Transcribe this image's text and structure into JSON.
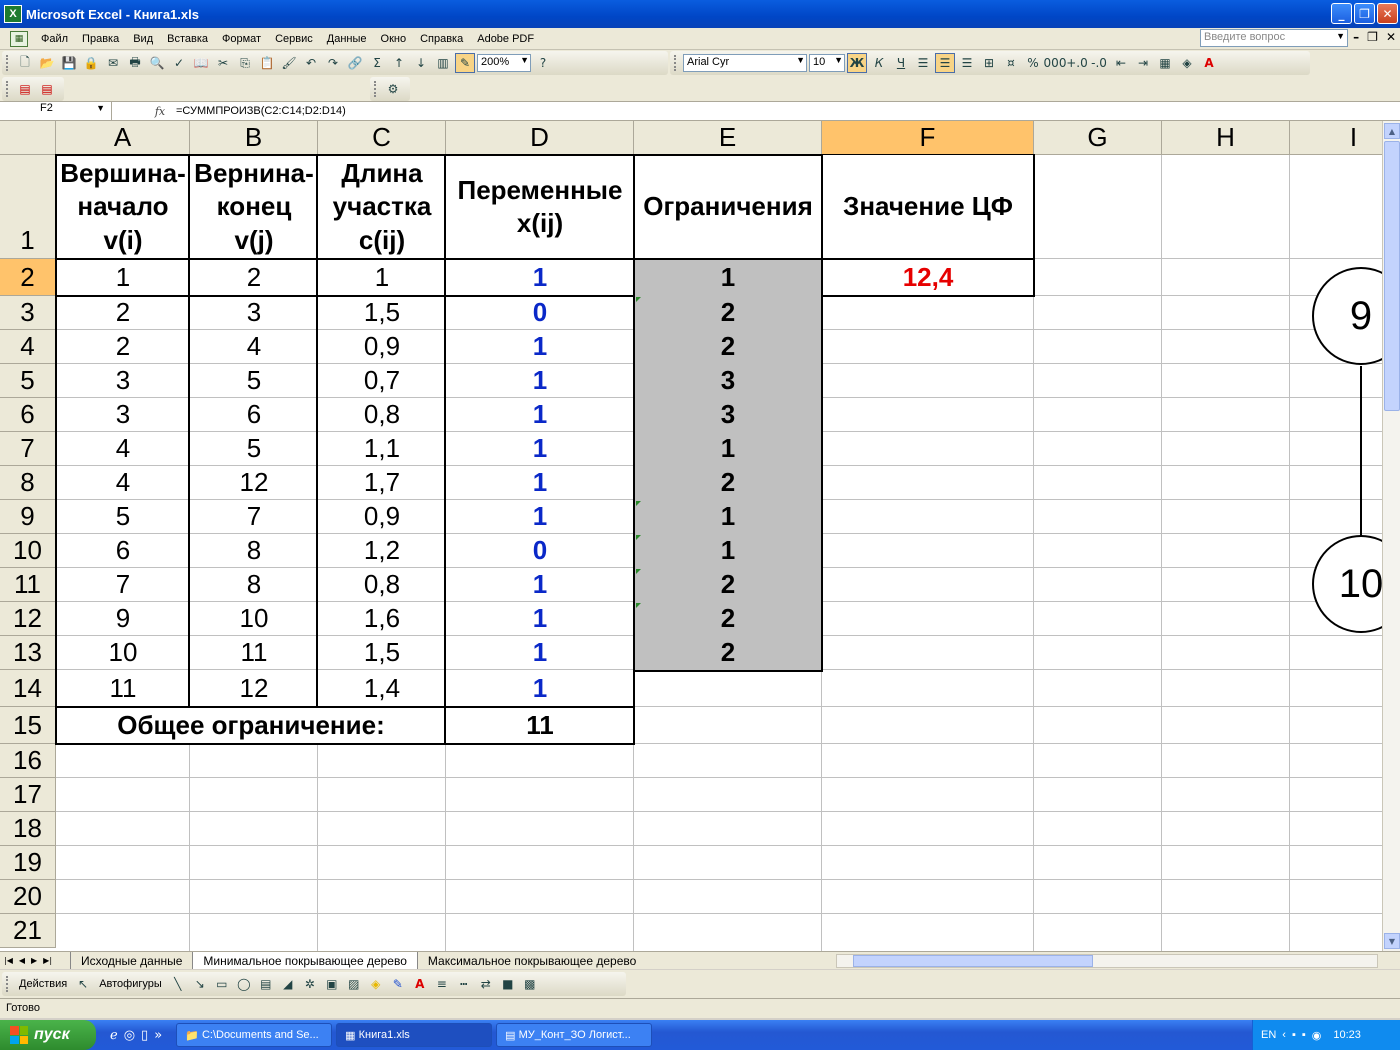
{
  "window": {
    "title": "Microsoft Excel - Книга1.xls",
    "app_icon": "X"
  },
  "menu": {
    "items": [
      "Файл",
      "Правка",
      "Вид",
      "Вставка",
      "Формат",
      "Сервис",
      "Данные",
      "Окно",
      "Справка",
      "Adobe PDF"
    ],
    "help_placeholder": "Введите вопрос"
  },
  "toolbar": {
    "zoom": "200%",
    "font": "Arial Cyr",
    "font_size": "10"
  },
  "formula_bar": {
    "cell_ref": "F2",
    "fx": "fx",
    "formula": "=СУММПРОИЗВ(C2:C14;D2:D14)"
  },
  "columns": [
    "A",
    "B",
    "C",
    "D",
    "E",
    "F",
    "G",
    "H",
    "I"
  ],
  "rows": [
    "1",
    "2",
    "3",
    "4",
    "5",
    "6",
    "7",
    "8",
    "9",
    "10",
    "11",
    "12",
    "13",
    "14",
    "15",
    "16",
    "17",
    "18",
    "19",
    "20",
    "21"
  ],
  "headers": {
    "a": "Вершина-\nначало\nv(i)",
    "b": "Вернина-\nконец\nv(j)",
    "c": "Длина\nучастка\nc(ij)",
    "d": "Переменные\nx(ij)",
    "e": "Ограничения",
    "f": "Значение ЦФ"
  },
  "data_rows": [
    {
      "a": "1",
      "b": "2",
      "c": "1",
      "d": "1",
      "e": "1"
    },
    {
      "a": "2",
      "b": "3",
      "c": "1,5",
      "d": "0",
      "e": "2"
    },
    {
      "a": "2",
      "b": "4",
      "c": "0,9",
      "d": "1",
      "e": "2"
    },
    {
      "a": "3",
      "b": "5",
      "c": "0,7",
      "d": "1",
      "e": "3"
    },
    {
      "a": "3",
      "b": "6",
      "c": "0,8",
      "d": "1",
      "e": "3"
    },
    {
      "a": "4",
      "b": "5",
      "c": "1,1",
      "d": "1",
      "e": "1"
    },
    {
      "a": "4",
      "b": "12",
      "c": "1,7",
      "d": "1",
      "e": "2"
    },
    {
      "a": "5",
      "b": "7",
      "c": "0,9",
      "d": "1",
      "e": "1"
    },
    {
      "a": "6",
      "b": "8",
      "c": "1,2",
      "d": "0",
      "e": "1"
    },
    {
      "a": "7",
      "b": "8",
      "c": "0,8",
      "d": "1",
      "e": "2"
    },
    {
      "a": "9",
      "b": "10",
      "c": "1,6",
      "d": "1",
      "e": "2"
    },
    {
      "a": "10",
      "b": "11",
      "c": "1,5",
      "d": "1",
      "e": "2"
    },
    {
      "a": "11",
      "b": "12",
      "c": "1,4",
      "d": "1",
      "e": ""
    }
  ],
  "objective_value": "12,4",
  "total": {
    "label": "Общее ограничение:",
    "value": "11"
  },
  "graph_nodes": [
    "9",
    "10"
  ],
  "sheet_tabs": [
    "Исходные данные",
    "Минимальное покрывающее дерево",
    "Максимальное покрывающее дерево"
  ],
  "active_tab": 1,
  "drawing_toolbar": {
    "actions": "Действия",
    "autoshapes": "Автофигуры"
  },
  "status": "Готово",
  "taskbar": {
    "start": "пуск",
    "tasks": [
      "C:\\Documents and Se...",
      "Книга1.xls",
      "МУ_Конт_ЗО Логист..."
    ],
    "lang": "EN",
    "clock": "10:23"
  },
  "colors": {
    "selected_header": "#ffc36b",
    "constraint_fill": "#c0c0c0",
    "variable_text": "#0a28c8",
    "objective_text": "#e60000"
  }
}
